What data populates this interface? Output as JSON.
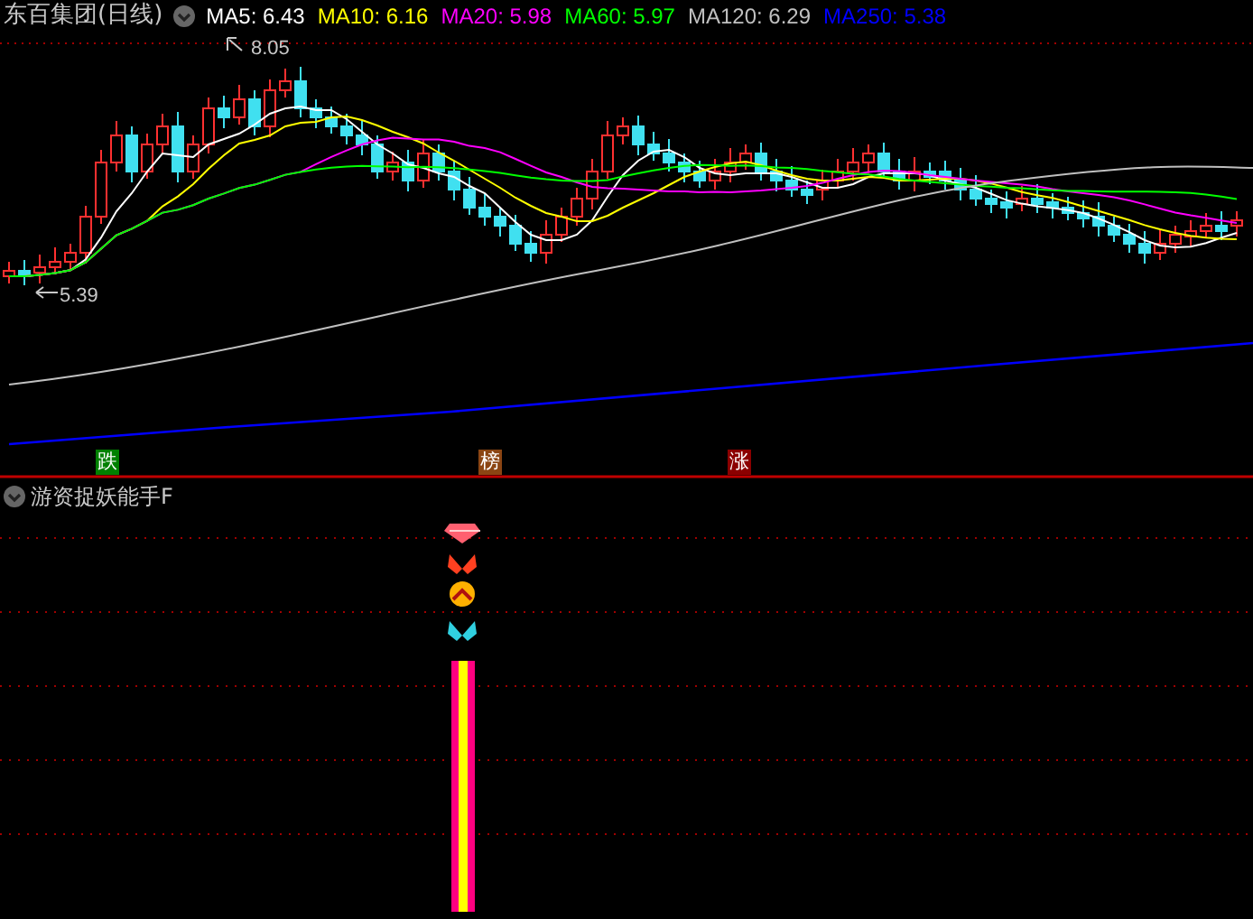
{
  "header": {
    "title": "东百集团(日线)",
    "averages": [
      {
        "text": "MA5: 6.43",
        "color": "#ffffff"
      },
      {
        "text": "MA10: 6.16",
        "color": "#ffff00"
      },
      {
        "text": "MA20: 5.98",
        "color": "#ff00ff"
      },
      {
        "text": "MA60: 5.97",
        "color": "#00ff00"
      },
      {
        "text": "MA120: 6.29",
        "color": "#c0c0c0"
      },
      {
        "text": "MA250: 5.38",
        "color": "#0000ff"
      }
    ]
  },
  "price_marks": {
    "high": "8.05",
    "low": "5.39"
  },
  "signals": [
    {
      "text": "跌",
      "color": "#008000"
    },
    {
      "text": "榜",
      "color": "#8b4513"
    },
    {
      "text": "涨",
      "color": "#8b0000"
    }
  ],
  "indicator": {
    "title": "游资捉妖能手F"
  }
}
